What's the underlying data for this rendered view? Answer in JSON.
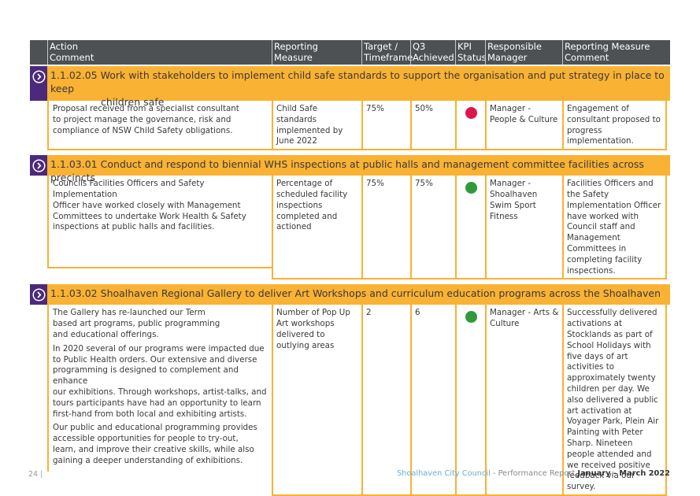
{
  "header": {
    "columns": [
      "Action\nComment",
      "Reporting\nMeasure",
      "Target /\nTimeframe",
      "Q3\nAchieved",
      "KPI\nStatus",
      "Responsible\nManager",
      "Reporting Measure\nComment"
    ]
  },
  "colors": {
    "header_bg": "#4d5153",
    "section_bar": "#f9b233",
    "arrow_bg": "#4b2a7b",
    "kpi_red": "#e0144c",
    "kpi_green": "#2e9a3a",
    "footer_org": "#6aaed6"
  },
  "sections": [
    {
      "code": "1.1.02.05",
      "title_line1": "Work with stakeholders to implement child safe standards to support the organisation and put strategy in place to keep",
      "title_line2": "children safe",
      "icon": "chevron-right-circle-icon",
      "comment": [
        "Proposal received from a specialist consultant\nto project manage the governance, risk and\ncompliance of NSW Child Safety obligations."
      ],
      "measure": "Child Safe standards\nimplemented\nby June 2022",
      "target": "75%",
      "achieved": "50%",
      "kpi_status": "red",
      "manager": "Manager -\nPeople & Culture",
      "measure_comment": "Engagement of\nconsultant proposed\nto progress\nimplementation."
    },
    {
      "code": "1.1.03.01",
      "title_line1": "Conduct and respond to biennial WHS inspections at public halls and management committee facilities across precincts",
      "title_line2": "",
      "icon": "chevron-right-circle-icon",
      "comment": [
        "Councils Facilities Officers and Safety Implementation\nOfficer have worked closely with Management\nCommittees to undertake Work Health & Safety\ninspections at public halls and facilities."
      ],
      "measure": "Percentage of\nscheduled facility\ninspections\ncompleted and\nactioned",
      "target": "75%",
      "achieved": "75%",
      "kpi_status": "green",
      "manager": "Manager -\nShoalhaven\nSwim Sport\nFitness",
      "measure_comment": "Facilities Officers and the\nSafety Implementation\nOfficer have worked\nwith Council staff\nand Management\nCommittees in\ncompleting facility\ninspections."
    },
    {
      "code": "1.1.03.02",
      "title_line1": "Shoalhaven Regional Gallery to deliver Art Workshops and curriculum education programs across the Shoalhaven",
      "title_line2": "",
      "icon": "chevron-right-circle-icon",
      "comment": [
        "The Gallery has re-launched our Term\nbased art programs, public programming\nand educational offerings.",
        "In 2020 several of our programs were impacted due\nto Public Health orders. Our extensive and diverse\nprogramming is designed to complement and enhance\nour exhibitions. Through workshops, artist-talks, and\ntours participants have had an opportunity to learn\nfirst-hand from both local and exhibiting artists.",
        "Our public and educational programming provides\naccessible opportunities for people to try-out,\nlearn, and improve their creative skills, while also\ngaining a deeper understanding of exhibitions."
      ],
      "measure": "Number of Pop\nUp Art workshops\ndelivered to\noutlying areas",
      "target": "2",
      "achieved": "6",
      "kpi_status": "green",
      "manager": "Manager -\nArts & Culture",
      "measure_comment": "Successfully delivered\nactivations at Stocklands\nas part of School\nHolidays with five\ndays of art activities\nto approximately\ntwenty children per\nday. We also delivered\na public art activation\nat Voyager Park, Plein\nAir Painting with\nPeter Sharp. Nineteen\npeople attended and\nwe received positive\nfeedback via our survey."
    }
  ],
  "footer": {
    "page_number": "24 |",
    "organisation": "Shoalhaven City Council",
    "separator": " - Performance Report ",
    "period": "January - March 2022"
  }
}
